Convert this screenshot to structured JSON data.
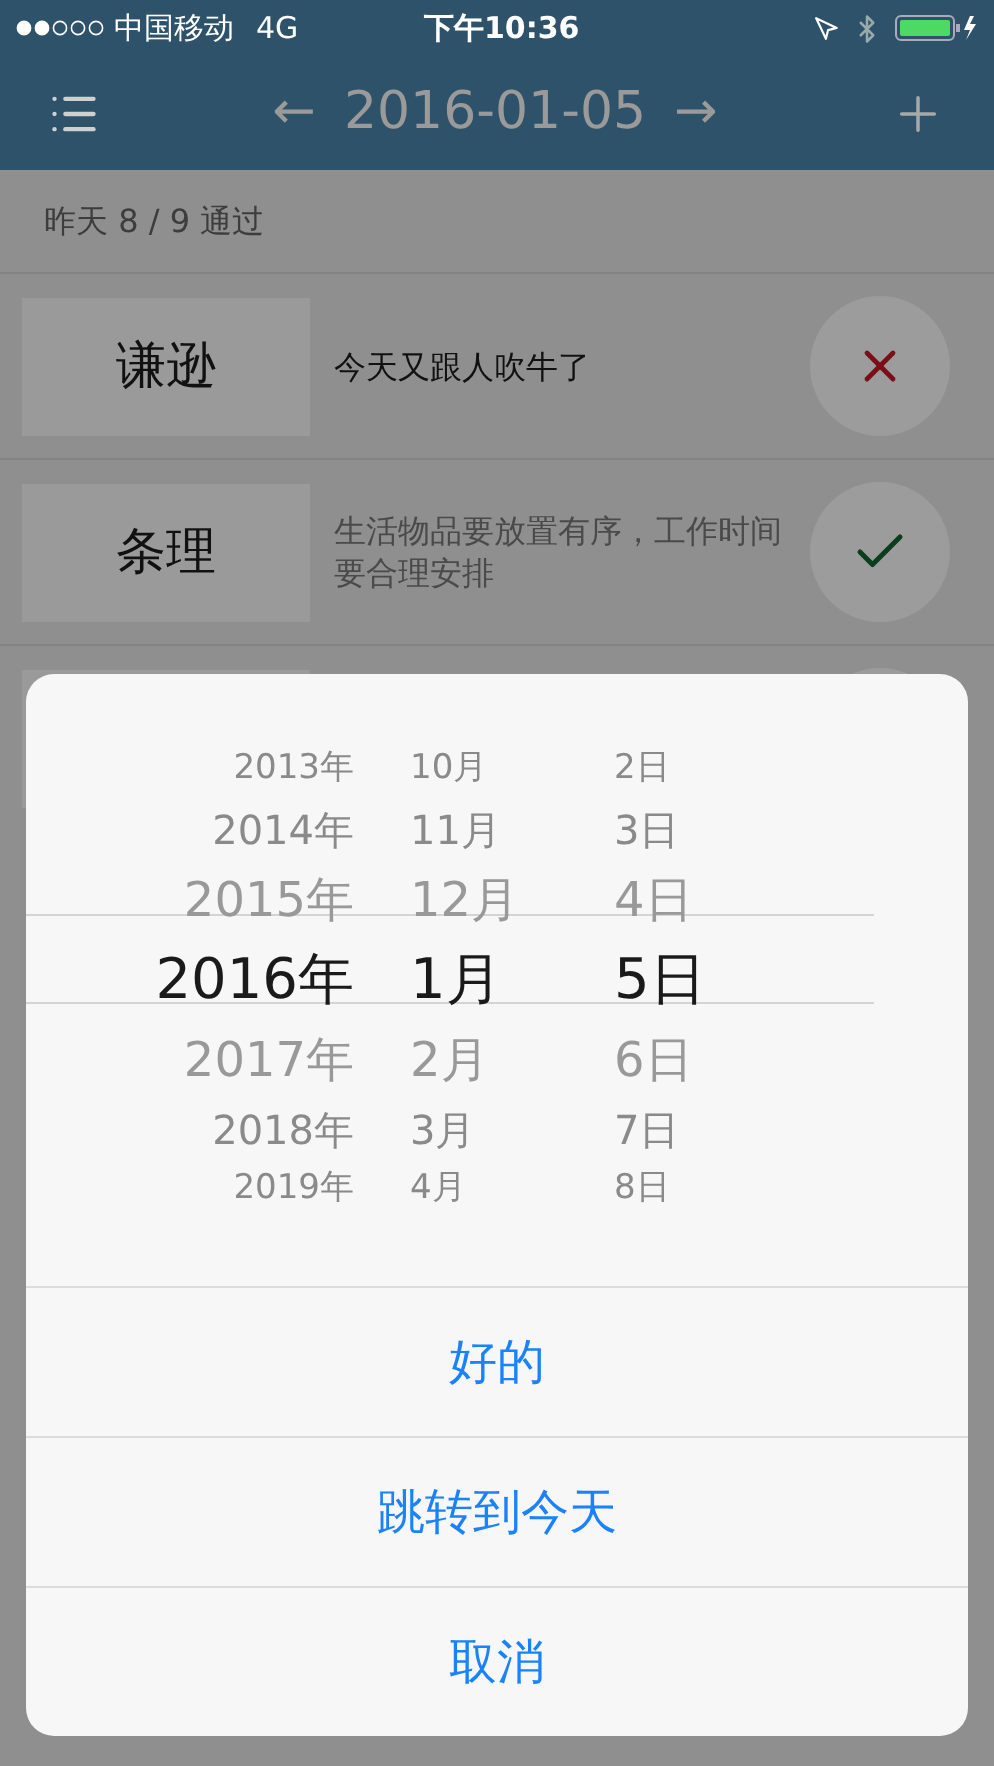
{
  "status_bar": {
    "carrier": "中国移动",
    "network": "4G",
    "time": "下午10:36"
  },
  "nav": {
    "prev": "←",
    "title": "2016-01-05",
    "next": "→"
  },
  "summary": "昨天 8 / 9 通过",
  "habits": [
    {
      "name": "谦逊",
      "note": "今天又跟人吹牛了",
      "passed": false
    },
    {
      "name": "条理",
      "note": "生活物品要放置有序，工作时间要合理安排",
      "passed": true
    }
  ],
  "date_picker": {
    "columns": [
      {
        "items": [
          {
            "label": "2013年",
            "selected": false
          },
          {
            "label": "2014年",
            "selected": false
          },
          {
            "label": "2015年",
            "selected": false
          },
          {
            "label": "2016年",
            "selected": true
          },
          {
            "label": "2017年",
            "selected": false
          },
          {
            "label": "2018年",
            "selected": false
          },
          {
            "label": "2019年",
            "selected": false
          }
        ]
      },
      {
        "items": [
          {
            "label": "10月",
            "selected": false
          },
          {
            "label": "11月",
            "selected": false
          },
          {
            "label": "12月",
            "selected": false
          },
          {
            "label": "1月",
            "selected": true
          },
          {
            "label": "2月",
            "selected": false
          },
          {
            "label": "3月",
            "selected": false
          },
          {
            "label": "4月",
            "selected": false
          }
        ]
      },
      {
        "items": [
          {
            "label": "2日",
            "selected": false
          },
          {
            "label": "3日",
            "selected": false
          },
          {
            "label": "4日",
            "selected": false
          },
          {
            "label": "5日",
            "selected": true
          },
          {
            "label": "6日",
            "selected": false
          },
          {
            "label": "7日",
            "selected": false
          },
          {
            "label": "8日",
            "selected": false
          }
        ]
      }
    ]
  },
  "actions": [
    "好的",
    "跳转到今天",
    "取消"
  ]
}
